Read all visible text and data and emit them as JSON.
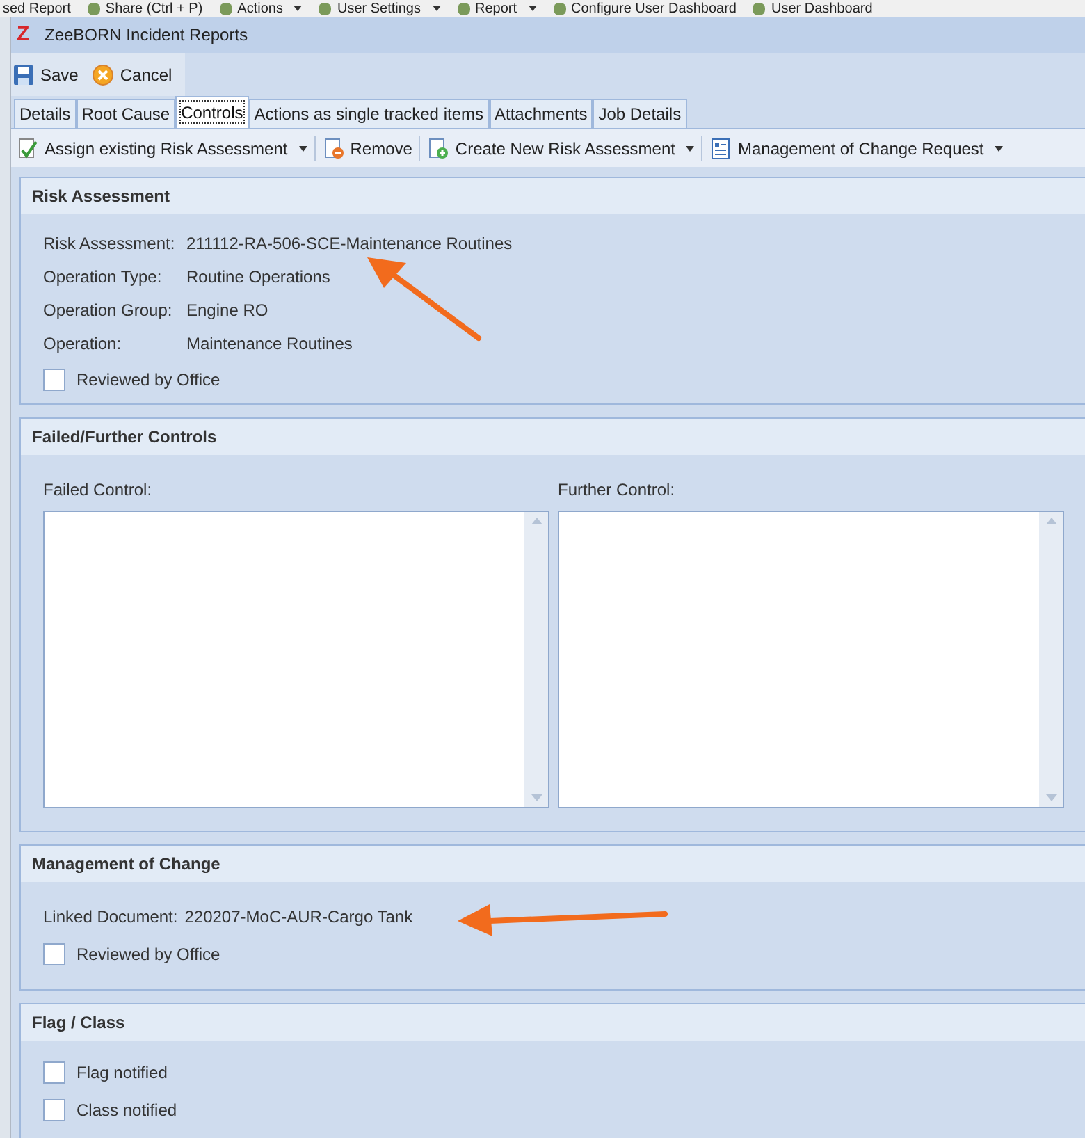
{
  "background_toolbar": [
    {
      "label": "sed Report",
      "icon": false,
      "dropdown": false
    },
    {
      "label": "Share (Ctrl + P)",
      "icon": true,
      "dropdown": false
    },
    {
      "label": "Actions",
      "icon": true,
      "dropdown": true
    },
    {
      "label": "User Settings",
      "icon": true,
      "dropdown": true
    },
    {
      "label": "Report",
      "icon": true,
      "dropdown": true
    },
    {
      "label": "Configure User Dashboard",
      "icon": true,
      "dropdown": false
    },
    {
      "label": "User Dashboard",
      "icon": true,
      "dropdown": false
    }
  ],
  "window": {
    "logo": "Z",
    "title": "ZeeBORN Incident Reports"
  },
  "toolbar": [
    {
      "kind": "save",
      "label": "Save"
    },
    {
      "kind": "cancel",
      "label": "Cancel"
    }
  ],
  "tabs": [
    {
      "label": "Details",
      "selected": false
    },
    {
      "label": "Root Cause",
      "selected": false
    },
    {
      "label": "Controls",
      "selected": true
    },
    {
      "label": "Actions as single tracked items",
      "selected": false
    },
    {
      "label": "Attachments",
      "selected": false
    },
    {
      "label": "Job Details",
      "selected": false
    }
  ],
  "action_bar": [
    {
      "kind": "assign",
      "label": "Assign existing Risk Assessment",
      "dropdown": true
    },
    {
      "kind": "remove",
      "label": "Remove",
      "dropdown": false
    },
    {
      "kind": "create",
      "label": "Create New Risk Assessment",
      "dropdown": true
    },
    {
      "kind": "form",
      "label": "Management of Change Request",
      "dropdown": true
    }
  ],
  "sections": [
    {
      "kind": "fields",
      "title": "Risk Assessment",
      "fields": [
        {
          "label": "Risk Assessment:",
          "value": "211112-RA-506-SCE-Maintenance Routines"
        },
        {
          "label": "Operation Type:",
          "value": "Routine Operations"
        },
        {
          "label": "Operation Group:",
          "value": "Engine RO"
        },
        {
          "label": "Operation:",
          "value": "Maintenance Routines"
        }
      ],
      "checkboxes": [
        {
          "label": "Reviewed by Office",
          "checked": false
        }
      ]
    },
    {
      "kind": "memos",
      "title": "Failed/Further Controls",
      "memos": [
        {
          "label": "Failed Control:"
        },
        {
          "label": "Further Control:"
        }
      ]
    },
    {
      "kind": "inline",
      "title": "Management of Change",
      "fields": [
        {
          "label": "Linked Document:",
          "value": "220207-MoC-AUR-Cargo Tank"
        }
      ],
      "checkboxes": [
        {
          "label": "Reviewed by Office",
          "checked": false
        }
      ]
    },
    {
      "kind": "checks",
      "title": "Flag / Class",
      "checkboxes": [
        {
          "label": "Flag notified",
          "checked": false
        },
        {
          "label": "Class notified",
          "checked": false
        }
      ]
    }
  ]
}
